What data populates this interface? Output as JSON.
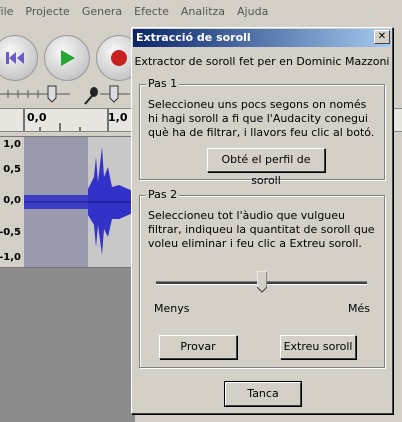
{
  "menu": [
    "File",
    "Projecte",
    "Genera",
    "Efecte",
    "Analitza",
    "Ajuda"
  ],
  "ruler": {
    "ticks": [
      "0,0",
      "1,0"
    ]
  },
  "track": {
    "yticks": [
      "1,0",
      "0,5",
      "0,0",
      "-0,5",
      "-1,0"
    ]
  },
  "dialog": {
    "title": "Extracció de soroll",
    "close": "✕",
    "subtitle": "Extractor de soroll fet per en Dominic Mazzoni",
    "step1": {
      "legend": "Pas 1",
      "text": "Seleccioneu uns pocs segons on només hi hagi soroll a fi que l'Audacity conegui què ha de filtrar, i llavors feu clic al botó.",
      "button": "Obté el perfil de soroll"
    },
    "step2": {
      "legend": "Pas 2",
      "text": "Seleccioneu tot l'àudio que vulgueu filtrar, indiqueu la quantitat de soroll que voleu eliminar i feu clic a Extreu soroll.",
      "slider_min": "Menys",
      "slider_max": "Més",
      "slider_value": 0.5,
      "preview_button": "Provar",
      "remove_button": "Extreu soroll"
    },
    "close_button": "Tanca"
  },
  "colors": {
    "title_start": "#0a246a",
    "title_end": "#a6caf0",
    "waveform": "#3232c8",
    "selection": "#9a9aae"
  }
}
